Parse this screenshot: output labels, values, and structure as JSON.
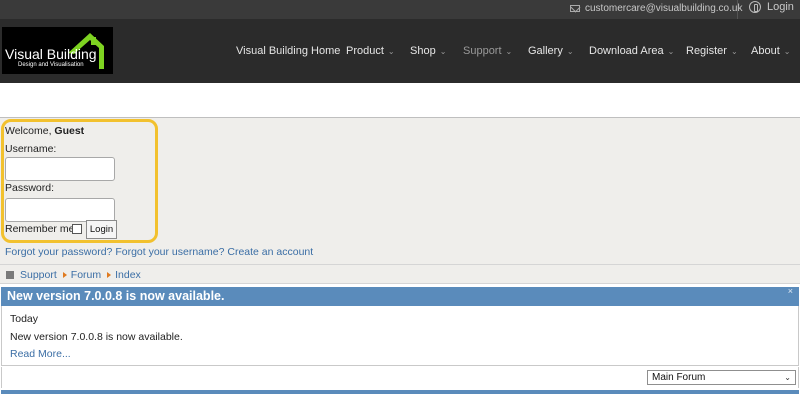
{
  "topbar": {
    "email": "customercare@visualbuilding.co.uk",
    "login_label": "Login",
    "icons": [
      "envelope-icon",
      "user-icon"
    ]
  },
  "logo": {
    "title": "Visual Building",
    "subtitle": "Design and Visualisation"
  },
  "nav": {
    "items": [
      {
        "label": "Visual Building Home",
        "has_dropdown": false
      },
      {
        "label": "Product",
        "has_dropdown": true
      },
      {
        "label": "Shop",
        "has_dropdown": true
      },
      {
        "label": "Support",
        "has_dropdown": true,
        "active": true
      },
      {
        "label": "Gallery",
        "has_dropdown": true
      },
      {
        "label": "Download Area",
        "has_dropdown": true
      },
      {
        "label": "Register",
        "has_dropdown": true
      },
      {
        "label": "About",
        "has_dropdown": true
      }
    ],
    "chevron": "⌄"
  },
  "login_form": {
    "welcome_prefix": "Welcome,",
    "welcome_user": "Guest",
    "username_label": "Username:",
    "username_value": "",
    "password_label": "Password:",
    "password_value": "",
    "remember_label": "Remember me",
    "remember_checked": false,
    "login_button": "Login"
  },
  "links": {
    "forgot_password": "Forgot your password?",
    "forgot_username": "Forgot your username?",
    "create_account": "Create an account"
  },
  "breadcrumb": [
    "Support",
    "Forum",
    "Index"
  ],
  "announcement": {
    "title": "New version 7.0.0.8 is now available.",
    "close": "×",
    "date": "Today",
    "body": "New version 7.0.0.8 is now available.",
    "read_more": "Read More..."
  },
  "forum_select": {
    "selected": "Main Forum"
  },
  "colors": {
    "topbar_bg": "#3a3a3a",
    "navbar_bg": "#2b2b2b",
    "accent_blue": "#5a8bbb",
    "link_blue": "#3b6ea5",
    "highlight_yellow": "#f2c12e",
    "panel_bg": "#efeeeb",
    "logo_green": "#7ed321"
  }
}
